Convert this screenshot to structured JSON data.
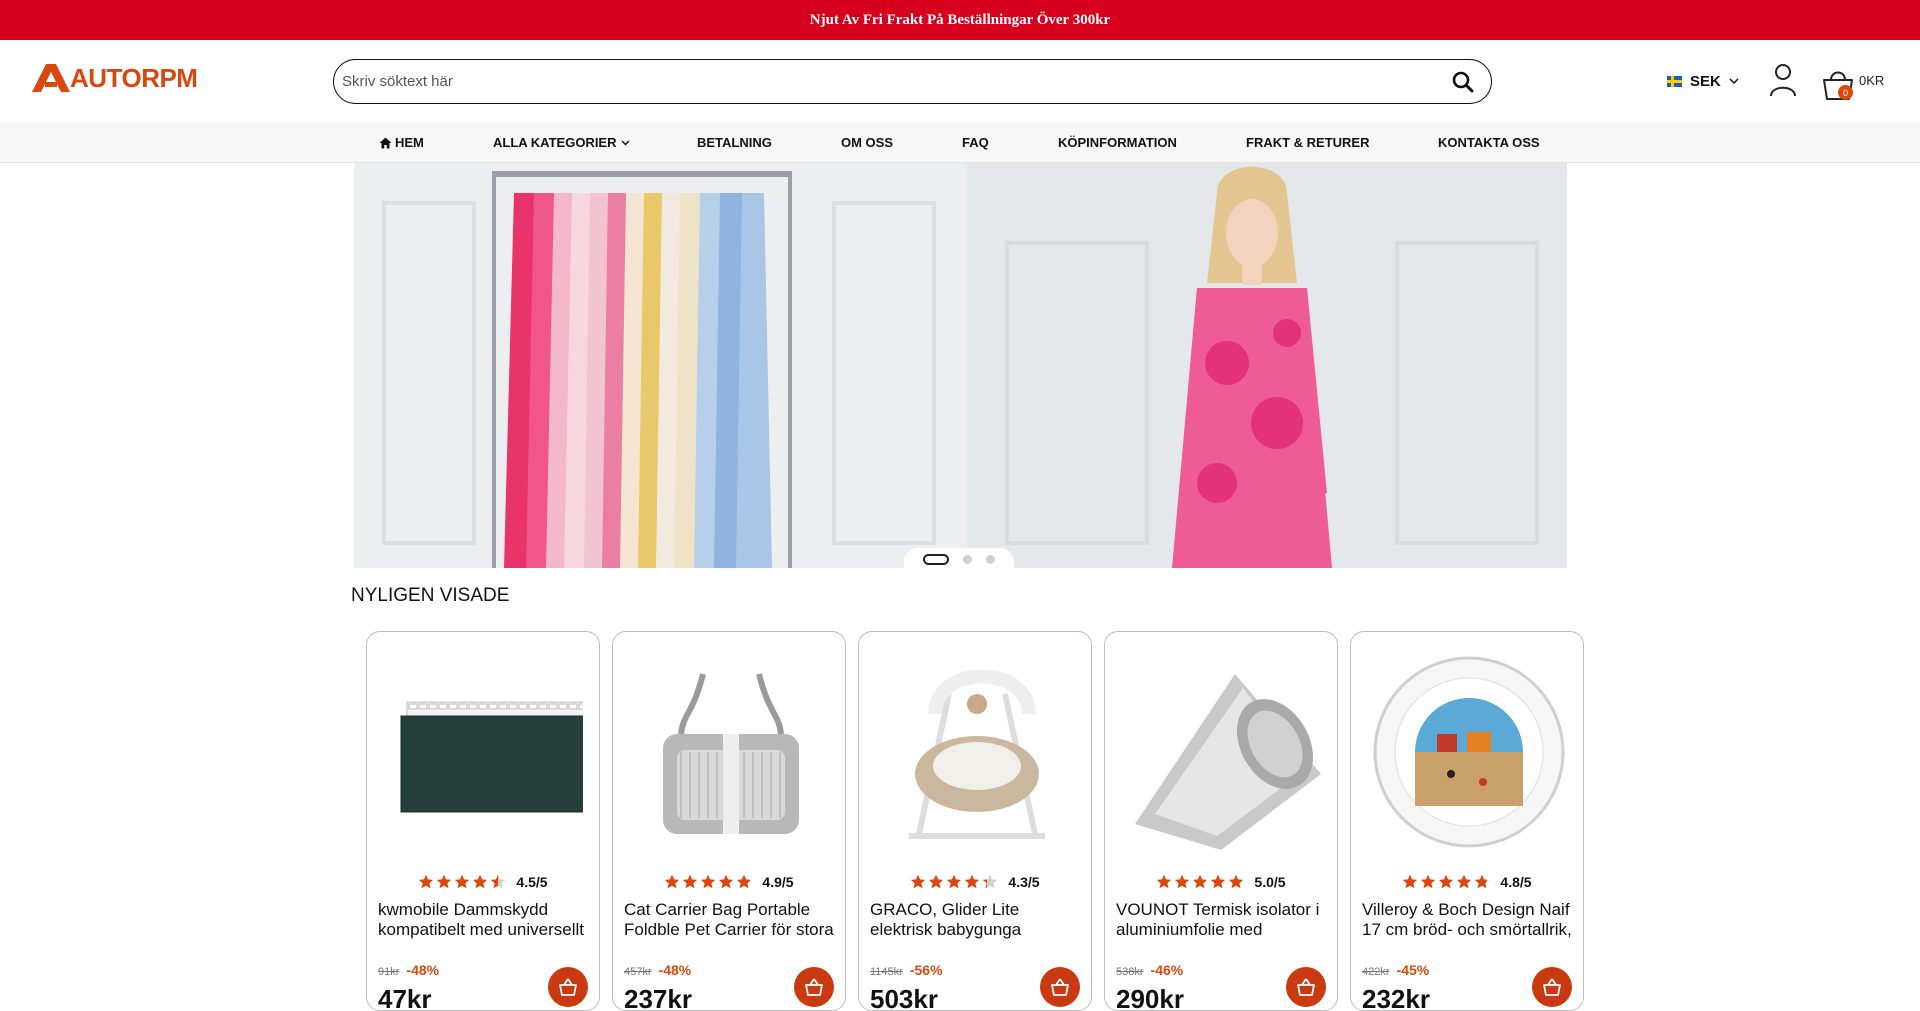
{
  "promo": {
    "text": "Njut Av Fri Frakt På Beställningar Över 300kr"
  },
  "logo": {
    "text": "AUTORPM",
    "color": "#d9480f"
  },
  "search": {
    "placeholder": "Skriv söktext här"
  },
  "currency": {
    "label": "SEK"
  },
  "cart": {
    "count": "0",
    "total": "0KR"
  },
  "nav": {
    "items": [
      {
        "label": "HEM",
        "icon": "home-icon"
      },
      {
        "label": "ALLA KATEGORIER",
        "icon": "chevron-down-icon"
      },
      {
        "label": "BETALNING"
      },
      {
        "label": "OM OSS"
      },
      {
        "label": "FAQ"
      },
      {
        "label": "KÖPINFORMATION"
      },
      {
        "label": "FRAKT & RETURER"
      },
      {
        "label": "KONTAKTA OSS"
      }
    ]
  },
  "carousel": {
    "slide_count": 3,
    "active_slide": 1
  },
  "recently_viewed": {
    "title": "NYLIGEN VISADE",
    "products": [
      {
        "rating": 4.5,
        "rating_text": "4.5/5",
        "title": "kwmobile Dammskydd kompatibelt med universellt",
        "old_price": "91kr",
        "discount": "-48%",
        "price": "47kr"
      },
      {
        "rating": 4.9,
        "rating_text": "4.9/5",
        "title": "Cat Carrier Bag Portable Foldble Pet Carrier för stora",
        "old_price": "457kr",
        "discount": "-48%",
        "price": "237kr"
      },
      {
        "rating": 4.3,
        "rating_text": "4.3/5",
        "title": "GRACO, Glider Lite elektrisk babygunga",
        "old_price": "1145kr",
        "discount": "-56%",
        "price": "503kr"
      },
      {
        "rating": 5.0,
        "rating_text": "5.0/5",
        "title": "VOUNOT Termisk isolator i aluminiumfolie med",
        "old_price": "538kr",
        "discount": "-46%",
        "price": "290kr"
      },
      {
        "rating": 4.8,
        "rating_text": "4.8/5",
        "title": "Villeroy & Boch Design Naif 17 cm bröd- och smörtallrik,",
        "old_price": "422kr",
        "discount": "-45%",
        "price": "232kr"
      }
    ]
  },
  "colors": {
    "promo_bg": "#d6001c",
    "accent": "#d9480f",
    "star": "#d9480f",
    "cart_button": "#c93a12"
  }
}
